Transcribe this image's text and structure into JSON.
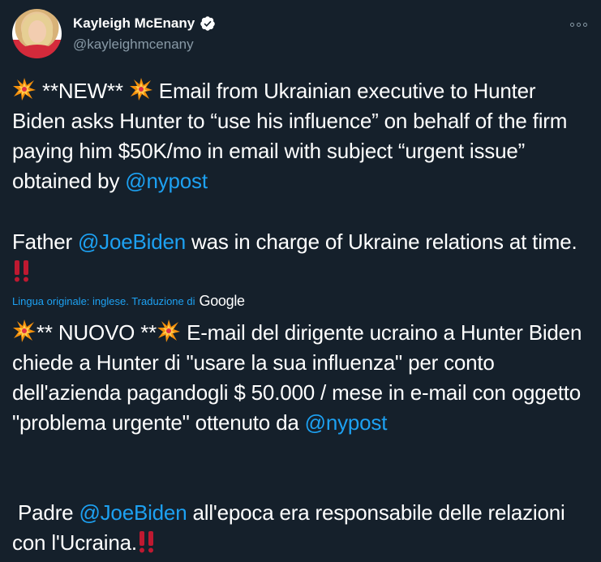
{
  "author": {
    "display_name": "Kayleigh McEnany",
    "handle": "@kayleighmcenany",
    "avatar_icon": "profile-photo",
    "verified_icon": "verified-badge-icon"
  },
  "menu": {
    "icon": "more-options-icon"
  },
  "tweet": {
    "line1_a": " **NEW** ",
    "line1_b": " Email from Ukrainian executive to Hunter Biden asks Hunter to “use his influence” on behalf of the firm paying him $50K/mo in email with subject “urgent issue” obtained by ",
    "mention_nypost": "@nypost",
    "line2_a": "Father ",
    "mention_joebiden": "@JoeBiden",
    "line2_b": " was in charge of Ukraine relations at time."
  },
  "translation": {
    "label": "Lingua originale: inglese. Traduzione di",
    "provider": "Google"
  },
  "translated": {
    "line1_a": "** NUOVO **",
    "line1_b": " E-mail del dirigente ucraino a Hunter Biden chiede a Hunter di \"usare la sua influenza\" per conto dell'azienda pagandogli $ 50.000 / mese in e-mail con oggetto \"problema urgente\" ottenuto da ",
    "mention_nypost": "@nypost",
    "line2_a": " Padre ",
    "mention_joebiden": "@JoeBiden",
    "line2_b": " all'epoca era responsabile delle relazioni con l'Ucraina."
  },
  "colors": {
    "background": "#15202b",
    "text": "#ffffff",
    "secondary_text": "#8899a6",
    "accent": "#1da1f2",
    "emphasis": "#e0245e"
  }
}
